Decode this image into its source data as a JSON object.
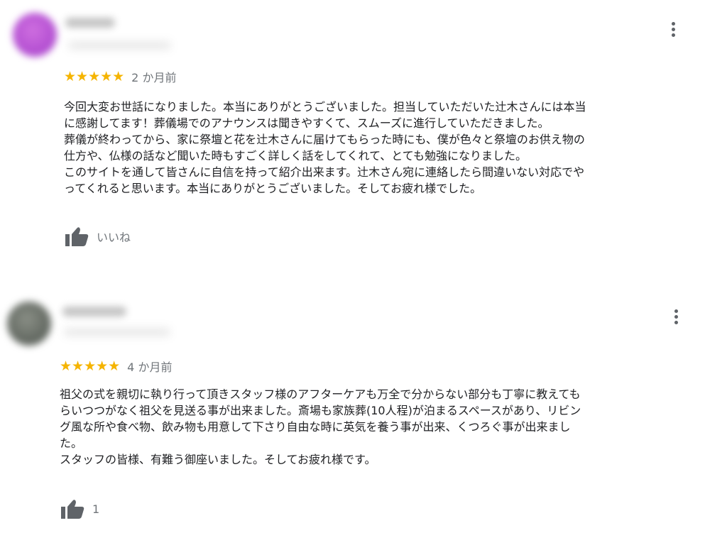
{
  "reviews": [
    {
      "rating_stars": "★★★★★",
      "date": "2 か月前",
      "text": "今回大変お世話になりました。本当にありがとうございました。担当していただいた辻木さんには本当\nに感謝してます！葬儀場でのアナウンスは聞きやすくて、スムーズに進行していただきました。\n葬儀が終わってから、家に祭壇と花を辻木さんに届けてもらった時にも、僕が色々と祭壇のお供え物の\n仕方や、仏様の話など聞いた時もすごく詳しく話をしてくれて、とても勉強になりました。\nこのサイトを通して皆さんに自信を持って紹介出来ます。辻木さん宛に連絡したら間違いない対応でや\nってくれると思います。本当にありがとうございました。そしてお疲れ様でした。",
      "like_label": "いいね",
      "rating_value": 5,
      "icons": {
        "more": "more-vert-icon",
        "like": "thumbs-up-icon"
      }
    },
    {
      "rating_stars": "★★★★★",
      "date": "4 か月前",
      "text": "祖父の式を親切に執り行って頂きスタッフ様のアフターケアも万全で分からない部分も丁寧に教えても\nらいつつがなく祖父を見送る事が出来ました。斎場も家族葬(10人程)が泊まるスペースがあり、リビン\nグ風な所や食べ物、飲み物も用意して下さり自由な時に英気を養う事が出来、くつろぐ事が出来まし\nた。\nスタッフの皆様、有難う御座いました。そしてお疲れ様です。",
      "like_label": "1",
      "rating_value": 5,
      "icons": {
        "more": "more-vert-icon",
        "like": "thumbs-up-icon"
      }
    }
  ],
  "colors": {
    "star": "#f5b400",
    "meta_text": "#70757a",
    "body_text": "#202124",
    "icon": "#5f6368"
  }
}
